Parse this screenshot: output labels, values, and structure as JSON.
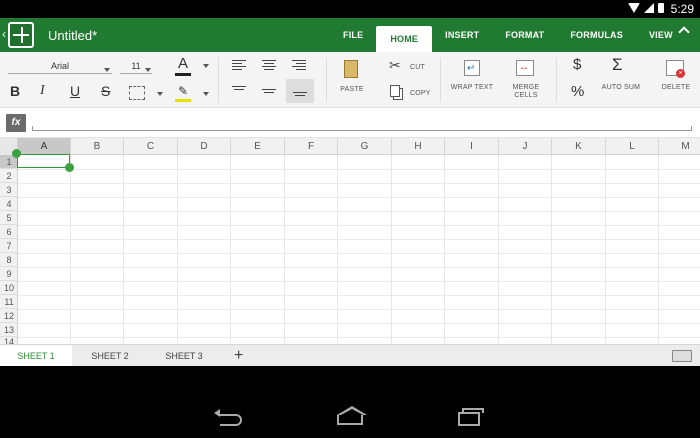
{
  "status_bar": {
    "time": "5:29"
  },
  "app_bar": {
    "document_title": "Untitled*",
    "tabs": [
      {
        "label": "FILE",
        "active": false
      },
      {
        "label": "HOME",
        "active": true
      },
      {
        "label": "INSERT",
        "active": false
      },
      {
        "label": "FORMAT",
        "active": false
      },
      {
        "label": "FORMULAS",
        "active": false
      },
      {
        "label": "VIEW",
        "active": false
      }
    ]
  },
  "ribbon": {
    "font_name": "Arial",
    "font_size": "11",
    "bold": "B",
    "italic": "I",
    "underline": "U",
    "strikethrough": "S",
    "font_color_glyph": "A",
    "paste_label": "PASTE",
    "cut_label": "CUT",
    "copy_label": "COPY",
    "wrap_text_label": "WRAP TEXT",
    "merge_cells_label": "MERGE CELLS",
    "currency_glyph": "$",
    "percent_glyph": "%",
    "auto_sum_glyph": "Σ",
    "auto_sum_label": "AUTO SUM",
    "delete_label": "DELETE"
  },
  "formula_bar": {
    "fx_label": "fx",
    "value": ""
  },
  "grid": {
    "columns": [
      "A",
      "B",
      "C",
      "D",
      "E",
      "F",
      "G",
      "H",
      "I",
      "J",
      "K",
      "L",
      "M"
    ],
    "rows": [
      "1",
      "2",
      "3",
      "4",
      "5",
      "6",
      "7",
      "8",
      "9",
      "10",
      "11",
      "12",
      "13",
      "14"
    ],
    "selected_cell": "A1"
  },
  "sheets": [
    {
      "label": "SHEET 1",
      "active": true
    },
    {
      "label": "SHEET 2",
      "active": false
    },
    {
      "label": "SHEET 3",
      "active": false
    }
  ],
  "add_sheet_glyph": "+",
  "colors": {
    "brand_green": "#217a32",
    "accent_green": "#2e9a3a"
  }
}
